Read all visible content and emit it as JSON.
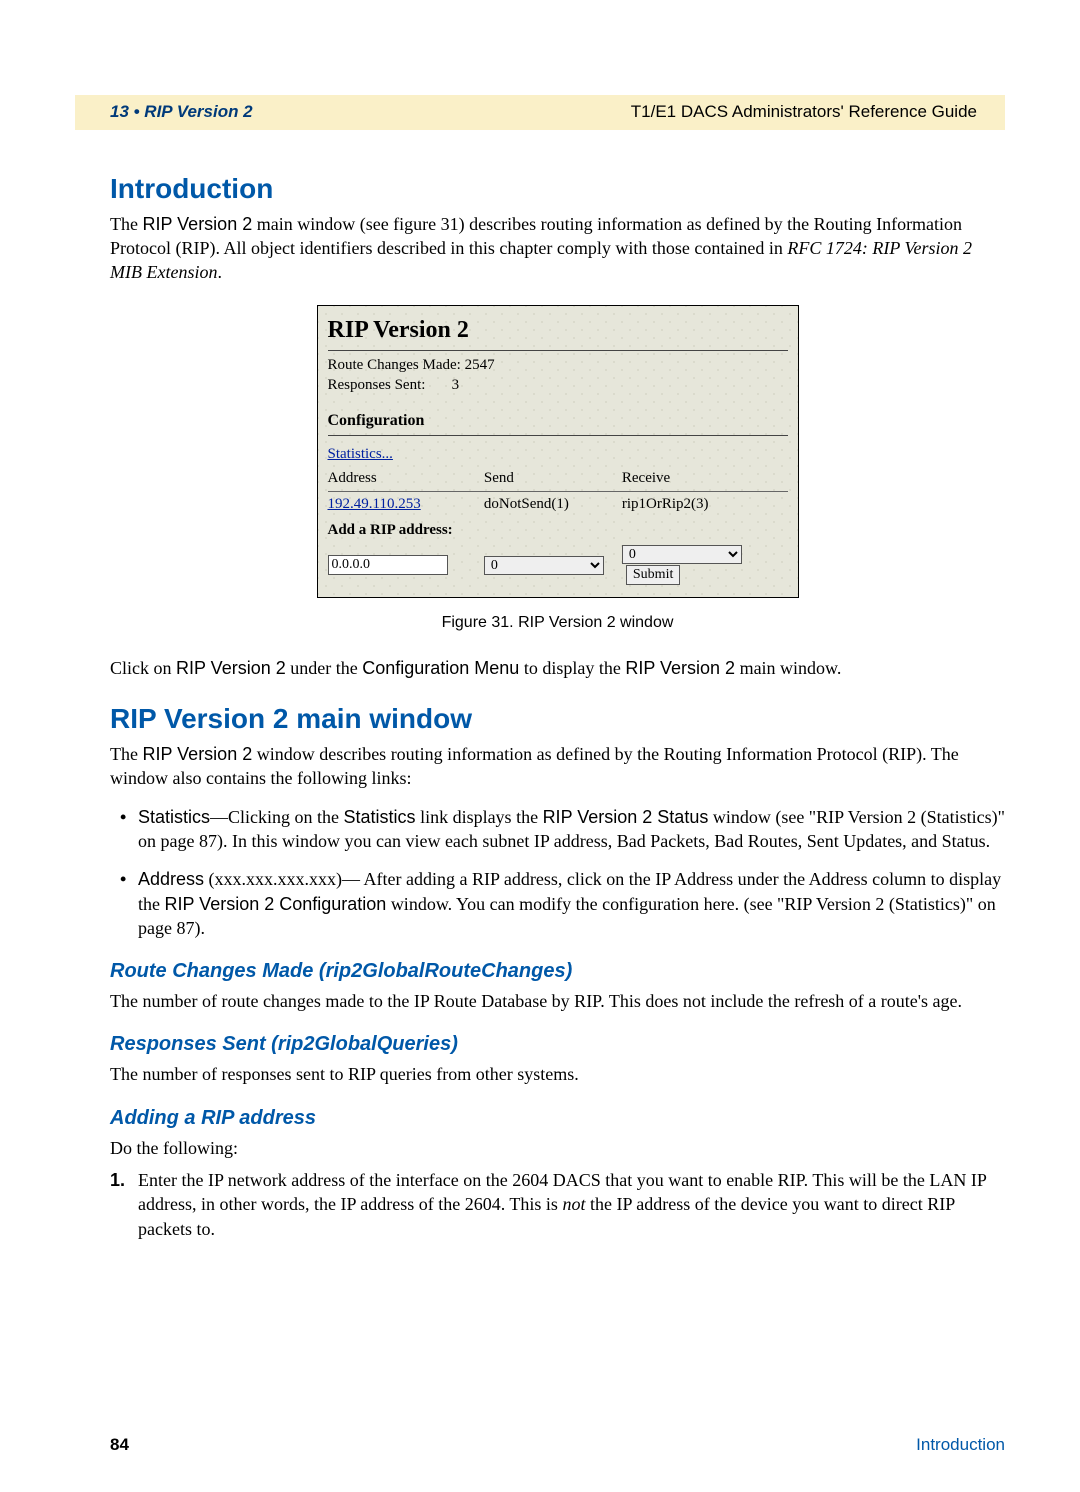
{
  "header": {
    "left": "13 • RIP Version 2",
    "right": "T1/E1 DACS Administrators' Reference Guide"
  },
  "h1_intro": "Introduction",
  "intro": {
    "p1_a": "The ",
    "p1_b": "RIP Version 2",
    "p1_c": " main window (see figure 31) describes routing information as defined by the Routing Information Protocol (RIP). All object identifiers described in this chapter comply with those contained in ",
    "p1_d": "RFC 1724: RIP Version 2 MIB Extension",
    "p1_e": "."
  },
  "shot": {
    "title": "RIP Version 2",
    "stat1_label": "Route Changes Made:",
    "stat1_val": "2547",
    "stat2_label": "Responses Sent:",
    "stat2_val": "3",
    "conf": "Configuration",
    "stats_link": "Statistics...",
    "col_addr": "Address",
    "col_send": "Send",
    "col_recv": "Receive",
    "row_addr": "192.49.110.253",
    "row_send": "doNotSend(1)",
    "row_recv": "rip1OrRip2(3)",
    "add_label": "Add a RIP address:",
    "ip_value": "0.0.0.0",
    "sel1": "0",
    "sel2": "0",
    "submit": "Submit"
  },
  "fig_caption": "Figure 31. RIP Version 2 window",
  "click_line": {
    "a": "Click on ",
    "b": "RIP Version 2",
    "c": " under the ",
    "d": "Configuration Menu",
    "e": " to display the ",
    "f": "RIP Version 2",
    "g": " main window."
  },
  "h1_main": "RIP Version 2 main window",
  "main_p": {
    "a": "The ",
    "b": "RIP Version 2",
    "c": " window describes routing information as defined by the Routing Information Protocol (RIP). The window also contains the following links:"
  },
  "bul1": {
    "a": "Statistics",
    "b": "—Clicking on the ",
    "c": "Statistics",
    "d": " link displays the ",
    "e": "RIP Version 2 Status",
    "f": " window  (see \"RIP Version 2 (Statistics)\" on page 87). In this window you can view each subnet IP address, Bad Packets, Bad Routes, Sent Updates, and Status."
  },
  "bul2": {
    "a": "Address",
    "b": " (xxx.xxx.xxx.xxx)— After adding a RIP address, click on the IP Address under the Address column to display the ",
    "c": "RIP Version 2 Configuration",
    "d": " window.  You can modify the configuration here.  (see \"RIP Version 2 (Statistics)\" on page 87)."
  },
  "sub1_h": "Route Changes Made (rip2GlobalRouteChanges)",
  "sub1_p": "The number of route changes made to the IP Route Database by RIP. This does not include the refresh of a route's age.",
  "sub2_h": "Responses Sent (rip2GlobalQueries)",
  "sub2_p": "The number of responses sent to RIP queries from other systems.",
  "sub3_h": "Adding a RIP address",
  "sub3_p": "Do the following:",
  "step1": {
    "num": "1.",
    "a": "Enter the IP network address of the interface on the 2604 DACS  that you want to enable RIP.  This will be the LAN IP address, in other words, the IP address of the 2604. This is ",
    "b": "not",
    "c": " the IP address of the device you want to direct RIP packets to."
  },
  "footer": {
    "page": "84",
    "label": "Introduction"
  }
}
